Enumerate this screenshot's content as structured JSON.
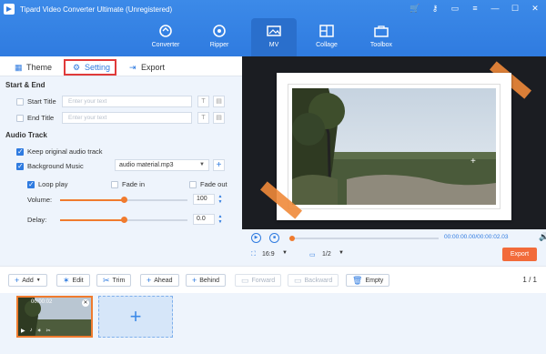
{
  "window": {
    "title": "Tipard Video Converter Ultimate (Unregistered)",
    "controls": [
      "cart-icon",
      "key-icon",
      "chat-icon",
      "menu-icon",
      "minimize-icon",
      "maximize-icon",
      "close-icon"
    ]
  },
  "nav": {
    "items": [
      {
        "label": "Converter",
        "icon": "converter-icon"
      },
      {
        "label": "Ripper",
        "icon": "ripper-icon"
      },
      {
        "label": "MV",
        "icon": "mv-icon",
        "active": true
      },
      {
        "label": "Collage",
        "icon": "collage-icon"
      },
      {
        "label": "Toolbox",
        "icon": "toolbox-icon"
      }
    ]
  },
  "tabs": [
    {
      "label": "Theme",
      "icon": "theme-icon"
    },
    {
      "label": "Setting",
      "icon": "gear-icon",
      "active": true
    },
    {
      "label": "Export",
      "icon": "export-icon"
    }
  ],
  "start_end": {
    "heading": "Start & End",
    "start_title_label": "Start Title",
    "start_title_placeholder": "Enter your text",
    "end_title_label": "End Title",
    "end_title_placeholder": "Enter your text"
  },
  "audio": {
    "heading": "Audio Track",
    "keep_original": {
      "label": "Keep original audio track",
      "checked": true
    },
    "background_music": {
      "label": "Background Music",
      "checked": true,
      "value": "audio material.mp3"
    },
    "loop_play": {
      "label": "Loop play",
      "checked": true
    },
    "fade_in": {
      "label": "Fade in",
      "checked": false
    },
    "fade_out": {
      "label": "Fade out",
      "checked": false
    },
    "volume": {
      "label": "Volume:",
      "value": "100",
      "fraction": 0.5
    },
    "delay": {
      "label": "Delay:",
      "value": "0.0",
      "fraction": 0.5
    }
  },
  "player": {
    "time": "00:00:00.00/00:00:02.03",
    "aspect": "16:9",
    "page": "1/2",
    "export_label": "Export"
  },
  "toolbar": {
    "add": "Add",
    "edit": "Edit",
    "trim": "Trim",
    "ahead": "Ahead",
    "behind": "Behind",
    "forward": "Forward",
    "backward": "Backward",
    "empty": "Empty",
    "page_indicator": "1 / 1"
  },
  "timeline": {
    "clip_time": "00:00:02",
    "add_symbol": "+"
  },
  "colors": {
    "header": "#2f7be0",
    "accent_orange": "#f07b2e",
    "export": "#f26b3a",
    "highlight_border": "#e03a3a"
  }
}
